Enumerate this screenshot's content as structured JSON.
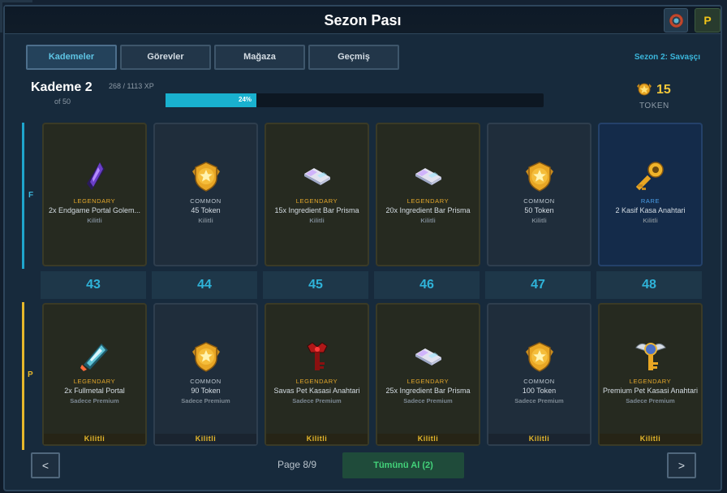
{
  "window": {
    "title": "Sezon Pası",
    "premium_badge": "P"
  },
  "tabs": [
    "Kademeler",
    "Görevler",
    "Mağaza",
    "Geçmiş"
  ],
  "season": "Sezon 2: Savaşçı",
  "tier": {
    "title": "Kademe 2",
    "of": "of 50",
    "xp_text": "268 / 1113 XP",
    "progress_percent": 24,
    "progress_label": "24%"
  },
  "token": {
    "count": "15",
    "label": "TOKEN"
  },
  "tracks": {
    "free_label": "F",
    "premium_label": "P"
  },
  "tier_numbers": [
    "43",
    "44",
    "45",
    "46",
    "47",
    "48"
  ],
  "free_rewards": [
    {
      "rarity": "LEGENDARY",
      "name": "2x Endgame Portal Golem...",
      "status": "Kilitli",
      "icon": "crystal-shard-icon"
    },
    {
      "rarity": "COMMON",
      "name": "45 Token",
      "status": "Kilitli",
      "icon": "token-badge-icon"
    },
    {
      "rarity": "LEGENDARY",
      "name": "15x Ingredient Bar Prisma",
      "status": "Kilitli",
      "icon": "ingredient-bar-icon"
    },
    {
      "rarity": "LEGENDARY",
      "name": "20x Ingredient Bar Prisma",
      "status": "Kilitli",
      "icon": "ingredient-bar-icon"
    },
    {
      "rarity": "COMMON",
      "name": "50 Token",
      "status": "Kilitli",
      "icon": "token-badge-icon"
    },
    {
      "rarity": "RARE",
      "name": "2 Kasif Kasa Anahtari",
      "status": "Kilitli",
      "icon": "golden-key-icon"
    }
  ],
  "premium_rewards": [
    {
      "rarity": "LEGENDARY",
      "name": "2x Fullmetal Portal",
      "status": "Sadece Premium",
      "lock": "Kilitli",
      "icon": "portal-crystal-icon"
    },
    {
      "rarity": "COMMON",
      "name": "90 Token",
      "status": "Sadece Premium",
      "lock": "Kilitli",
      "icon": "token-badge-icon"
    },
    {
      "rarity": "LEGENDARY",
      "name": "Savas Pet Kasasi Anahtari",
      "status": "Sadece Premium",
      "lock": "Kilitli",
      "icon": "red-key-icon"
    },
    {
      "rarity": "LEGENDARY",
      "name": "25x Ingredient Bar Prisma",
      "status": "Sadece Premium",
      "lock": "Kilitli",
      "icon": "ingredient-bar-icon"
    },
    {
      "rarity": "COMMON",
      "name": "100 Token",
      "status": "Sadece Premium",
      "lock": "Kilitli",
      "icon": "token-badge-icon"
    },
    {
      "rarity": "LEGENDARY",
      "name": "Premium Pet Kasasi Anahtari",
      "status": "Sadece Premium",
      "lock": "Kilitli",
      "icon": "winged-key-icon"
    }
  ],
  "footer": {
    "prev": "<",
    "page": "Page 8/9",
    "claim": "Tümünü Al (2)",
    "next": ">"
  },
  "colors": {
    "accent": "#19b1cf",
    "legendary": "#e6a92b",
    "rare": "#4a9ee8",
    "claim": "#43d37a",
    "token": "#f3c83a"
  }
}
